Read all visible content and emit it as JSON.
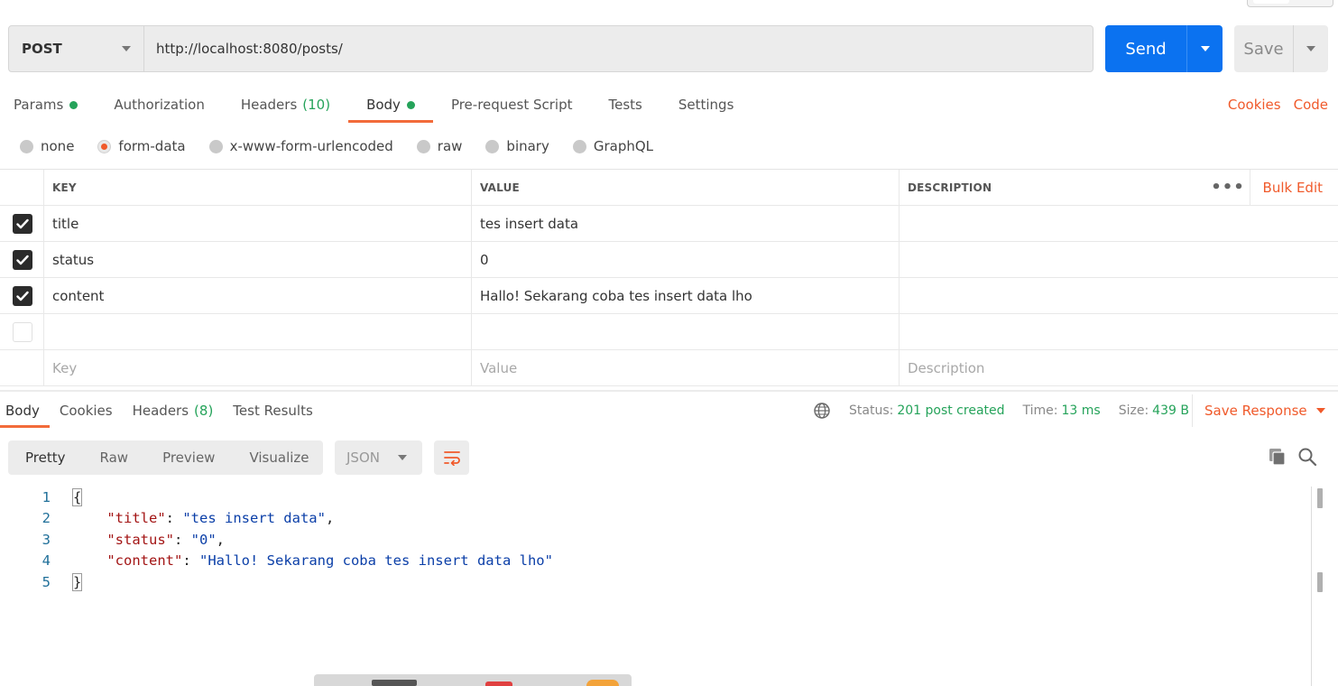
{
  "request": {
    "method": "POST",
    "url": "http://localhost:8080/posts/",
    "send_label": "Send",
    "save_label": "Save"
  },
  "request_tabs": [
    {
      "label": "Params",
      "dot": true
    },
    {
      "label": "Authorization"
    },
    {
      "label": "Headers",
      "count": "(10)"
    },
    {
      "label": "Body",
      "dot": true,
      "active": true
    },
    {
      "label": "Pre-request Script"
    },
    {
      "label": "Tests"
    },
    {
      "label": "Settings"
    }
  ],
  "request_links": {
    "cookies": "Cookies",
    "code": "Code"
  },
  "body_types": [
    {
      "label": "none"
    },
    {
      "label": "form-data",
      "selected": true
    },
    {
      "label": "x-www-form-urlencoded"
    },
    {
      "label": "raw"
    },
    {
      "label": "binary"
    },
    {
      "label": "GraphQL"
    }
  ],
  "params_table": {
    "headers": {
      "key": "KEY",
      "value": "VALUE",
      "description": "DESCRIPTION",
      "bulk_edit": "Bulk Edit"
    },
    "rows": [
      {
        "checked": true,
        "key": "title",
        "value": "tes insert data",
        "description": ""
      },
      {
        "checked": true,
        "key": "status",
        "value": "0",
        "description": ""
      },
      {
        "checked": true,
        "key": "content",
        "value": "Hallo! Sekarang coba tes insert data lho",
        "description": ""
      },
      {
        "checked": false,
        "key": "",
        "value": "",
        "description": ""
      }
    ],
    "placeholders": {
      "key": "Key",
      "value": "Value",
      "description": "Description"
    }
  },
  "response_tabs": [
    {
      "label": "Body",
      "active": true
    },
    {
      "label": "Cookies"
    },
    {
      "label": "Headers",
      "count": "(8)"
    },
    {
      "label": "Test Results"
    }
  ],
  "response_status": {
    "status_label": "Status:",
    "status_value": "201 post created",
    "time_label": "Time:",
    "time_value": "13 ms",
    "size_label": "Size:",
    "size_value": "439 B",
    "save_response": "Save Response"
  },
  "response_views": [
    "Pretty",
    "Raw",
    "Preview",
    "Visualize"
  ],
  "response_format": "JSON",
  "response_lines": [
    {
      "num": "1",
      "text": "{"
    },
    {
      "num": "2",
      "key": "\"title\"",
      "value": "\"tes insert data\"",
      "trail": ","
    },
    {
      "num": "3",
      "key": "\"status\"",
      "value": "\"0\"",
      "trail": ","
    },
    {
      "num": "4",
      "key": "\"content\"",
      "value": "\"Hallo! Sekarang coba tes insert data lho\"",
      "trail": ""
    },
    {
      "num": "5",
      "text": "}"
    }
  ],
  "colors": {
    "accent": "#f26b3a",
    "send": "#0b72f0",
    "success": "#25a35a"
  }
}
